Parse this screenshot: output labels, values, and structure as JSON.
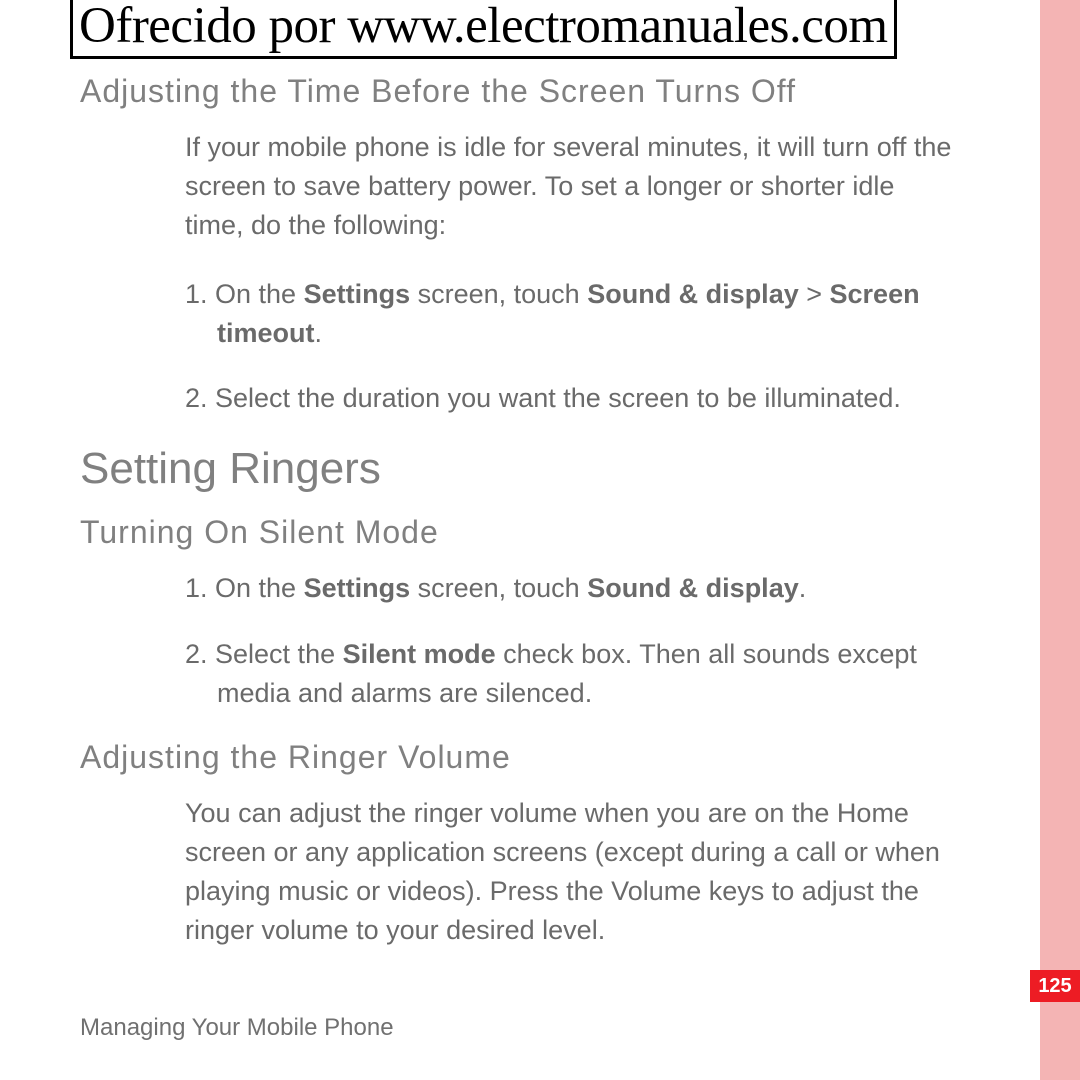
{
  "header": "Ofrecido por www.electromanuales.com",
  "section1": {
    "title": "Adjusting the Time Before the Screen Turns Off",
    "intro": "If your mobile phone is idle for several minutes, it will turn off the screen to save battery power. To set a longer or shorter idle time, do the following:",
    "step1_prefix": "1. On the ",
    "step1_b1": "Settings",
    "step1_mid": " screen, touch ",
    "step1_b2": "Sound & display",
    "step1_sep": " > ",
    "step1_b3": "Screen timeout",
    "step1_end": ".",
    "step2": "2. Select the duration you want the screen to be illuminated."
  },
  "mainHeading": "Setting Ringers",
  "section2": {
    "title": "Turning On Silent Mode",
    "step1_prefix": "1. On the ",
    "step1_b1": "Settings",
    "step1_mid": " screen, touch ",
    "step1_b2": "Sound & display",
    "step1_end": ".",
    "step2_prefix": "2. Select the ",
    "step2_b1": "Silent mode",
    "step2_end": " check box. Then all sounds except media and alarms are silenced."
  },
  "section3": {
    "title": "Adjusting the Ringer Volume",
    "body": "You can adjust the ringer volume when you are on the Home screen or any application screens (except during a call or when playing music or videos). Press the Volume keys to adjust the ringer volume to your desired level."
  },
  "footer": "Managing Your Mobile Phone",
  "pageNumber": "125"
}
